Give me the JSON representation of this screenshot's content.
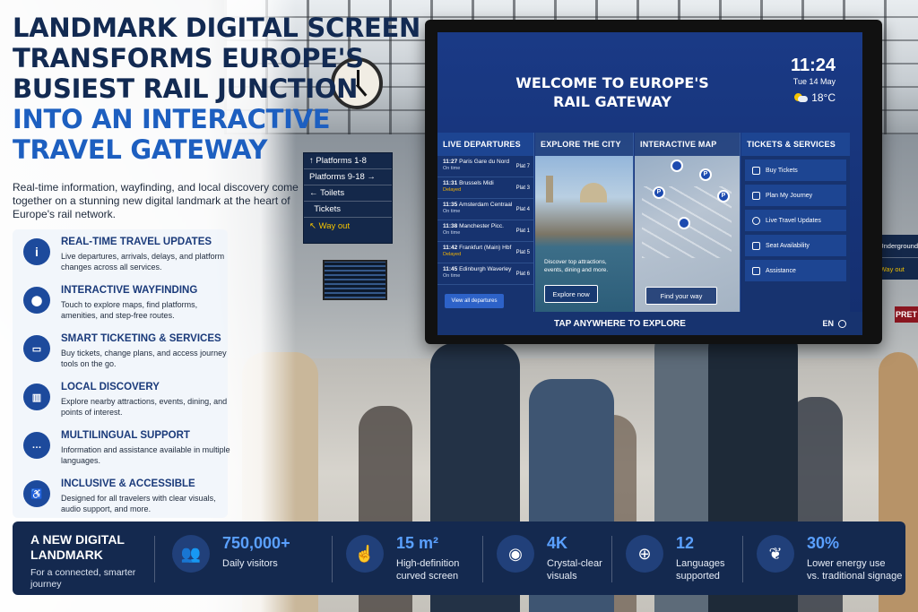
{
  "headline": {
    "line1": "LANDMARK DIGITAL SCREEN",
    "line2": "TRANSFORMS EUROPE'S",
    "line3": "BUSIEST RAIL JUNCTION",
    "line4": "INTO AN INTERACTIVE",
    "line5": "TRAVEL GATEWAY"
  },
  "intro": "Real-time information, wayfinding, and local discovery come together on a stunning new digital landmark at the heart of Europe's rail network.",
  "features": [
    {
      "icon": "info-icon",
      "title": "REAL-TIME TRAVEL UPDATES",
      "desc": "Live departures, arrivals, delays, and platform changes across all services."
    },
    {
      "icon": "location-pin-icon",
      "title": "INTERACTIVE WAYFINDING",
      "desc": "Touch to explore maps, find platforms, amenities, and step-free routes."
    },
    {
      "icon": "ticket-icon",
      "title": "SMART TICKETING & SERVICES",
      "desc": "Buy tickets, change plans, and access journey tools on the go."
    },
    {
      "icon": "city-buildings-icon",
      "title": "LOCAL DISCOVERY",
      "desc": "Explore nearby attractions, events, dining, and points of interest."
    },
    {
      "icon": "chat-bubble-icon",
      "title": "MULTILINGUAL SUPPORT",
      "desc": "Information and assistance available in multiple languages."
    },
    {
      "icon": "wheelchair-icon",
      "title": "INCLUSIVE & ACCESSIBLE",
      "desc": "Designed for all travelers with clear visuals, audio support, and more."
    }
  ],
  "station_sign": {
    "rows": [
      "Platforms 1-8",
      "Platforms 9-18",
      "Toilets",
      "Tickets",
      "Way out"
    ]
  },
  "underground_sign": {
    "line1": "Underground",
    "line2": "Way out"
  },
  "shop_sign": "PRET",
  "screen": {
    "title_line1": "WELCOME TO EUROPE'S",
    "title_line2": "RAIL GATEWAY",
    "time": "11:24",
    "date": "Tue 14 May",
    "weather": "18°C",
    "departures": {
      "header": "LIVE DEPARTURES",
      "rows": [
        {
          "time": "11:27",
          "dest": "Paris Gare du Nord",
          "status": "On time",
          "platform": "Plat 7"
        },
        {
          "time": "11:31",
          "dest": "Brussels Midi",
          "status": "Delayed",
          "platform": "Plat 3"
        },
        {
          "time": "11:35",
          "dest": "Amsterdam Centraal",
          "status": "On time",
          "platform": "Plat 4"
        },
        {
          "time": "11:38",
          "dest": "Manchester Picc.",
          "status": "On time",
          "platform": "Plat 1"
        },
        {
          "time": "11:42",
          "dest": "Frankfurt (Main) Hbf",
          "status": "Delayed",
          "platform": "Plat 5"
        },
        {
          "time": "11:45",
          "dest": "Edinburgh Waverley",
          "status": "On time",
          "platform": "Plat 6"
        }
      ],
      "button": "View all departures"
    },
    "city": {
      "header": "EXPLORE THE CITY",
      "text": "Discover top attractions, events, dining and more.",
      "button": "Explore now"
    },
    "map": {
      "header": "INTERACTIVE MAP",
      "pin_label": "P",
      "button": "Find your way"
    },
    "tickets": {
      "header": "TICKETS & SERVICES",
      "items": [
        "Buy Tickets",
        "Plan My Journey",
        "Live Travel Updates",
        "Seat Availability",
        "Assistance"
      ]
    },
    "footer": "TAP ANYWHERE TO EXPLORE",
    "language": "EN"
  },
  "statbar": {
    "title": "A NEW DIGITAL LANDMARK",
    "subtitle": "For a connected, smarter journey",
    "stats": [
      {
        "icon": "people-icon",
        "value": "750,000+",
        "label1": "Daily visitors",
        "label2": ""
      },
      {
        "icon": "touch-icon",
        "value": "15 m²",
        "label1": "High-definition",
        "label2": "curved screen"
      },
      {
        "icon": "eye-icon",
        "value": "4K",
        "label1": "Crystal-clear",
        "label2": "visuals"
      },
      {
        "icon": "globe-icon",
        "value": "12",
        "label1": "Languages",
        "label2": "supported"
      },
      {
        "icon": "leaf-icon",
        "value": "30%",
        "label1": "Lower energy use",
        "label2": "vs. traditional signage"
      }
    ]
  },
  "colors": {
    "navy": "#122a52",
    "accent_blue": "#1d5fc0",
    "screen_blue": "#1a3a86",
    "stat_value": "#5aa0ff",
    "delayed": "#f5b400",
    "wayout_yellow": "#f5c400"
  }
}
